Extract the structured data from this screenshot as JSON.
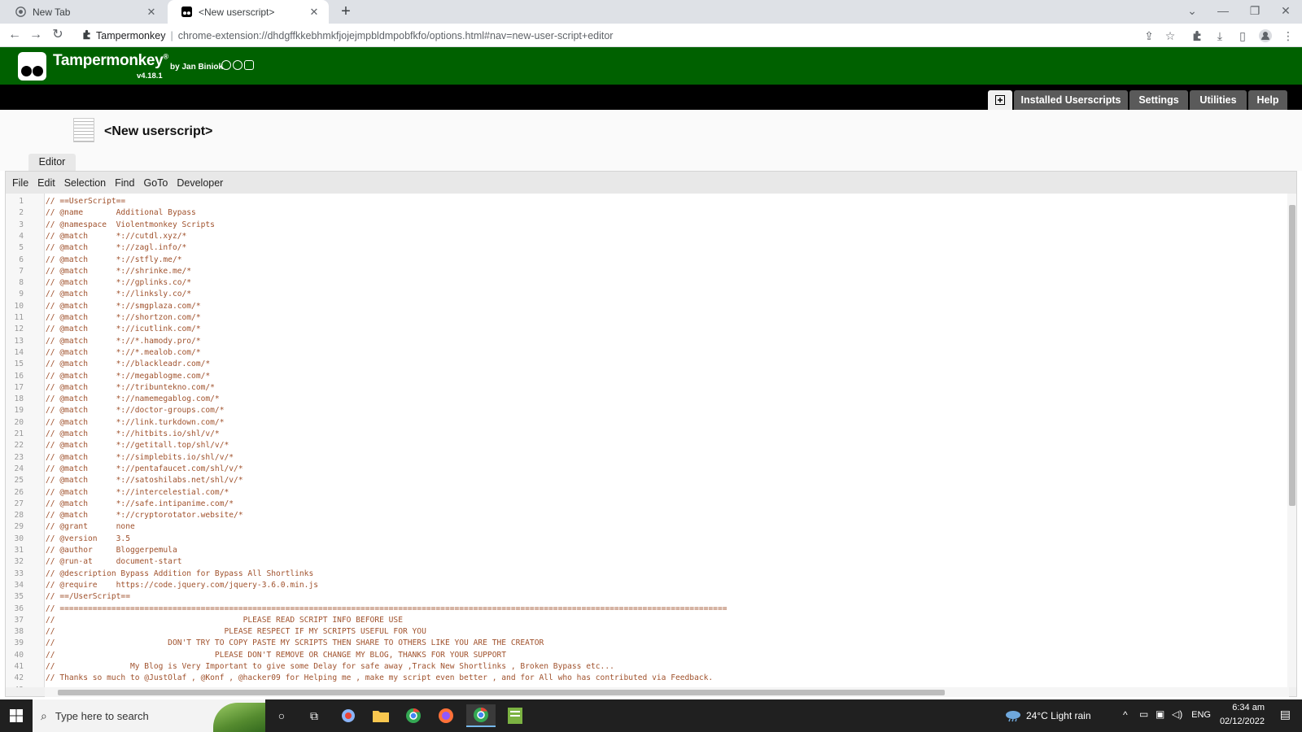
{
  "browser": {
    "tabs": [
      {
        "title": "New Tab",
        "active": false
      },
      {
        "title": "<New userscript>",
        "active": true
      }
    ],
    "omnibox": {
      "extension_name": "Tampermonkey",
      "separator": "|",
      "url": "chrome-extension://dhdgffkkebhmkfjojejmpbldmpobfkfo/options.html#nav=new-user-script+editor"
    }
  },
  "tampermonkey": {
    "title": "Tampermonkey",
    "registered": "®",
    "version": "v4.18.1",
    "by": "by Jan Biniok",
    "nav_tabs": [
      "Installed Userscripts",
      "Settings",
      "Utilities",
      "Help"
    ],
    "script_title": "<New userscript>",
    "editor_tab": "Editor",
    "editor_menu": [
      "File",
      "Edit",
      "Selection",
      "Find",
      "GoTo",
      "Developer"
    ]
  },
  "code": [
    "// ==UserScript==",
    "// @name       Additional Bypass",
    "// @namespace  Violentmonkey Scripts",
    "// @match      *://cutdl.xyz/*",
    "// @match      *://zagl.info/*",
    "// @match      *://stfly.me/*",
    "// @match      *://shrinke.me/*",
    "// @match      *://gplinks.co/*",
    "// @match      *://linksly.co/*",
    "// @match      *://smgplaza.com/*",
    "// @match      *://shortzon.com/*",
    "// @match      *://icutlink.com/*",
    "// @match      *://*.hamody.pro/*",
    "// @match      *://*.mealob.com/*",
    "// @match      *://blackleadr.com/*",
    "// @match      *://megablogme.com/*",
    "// @match      *://tribuntekno.com/*",
    "// @match      *://namemegablog.com/*",
    "// @match      *://doctor-groups.com/*",
    "// @match      *://link.turkdown.com/*",
    "// @match      *://hitbits.io/shl/v/*",
    "// @match      *://getitall.top/shl/v/*",
    "// @match      *://simplebits.io/shl/v/*",
    "// @match      *://pentafaucet.com/shl/v/*",
    "// @match      *://satoshilabs.net/shl/v/*",
    "// @match      *://intercelestial.com/*",
    "// @match      *://safe.intipanime.com/*",
    "// @match      *://cryptorotator.website/*",
    "// @grant      none",
    "// @version    3.5",
    "// @author     Bloggerpemula",
    "// @run-at     document-start",
    "// @description Bypass Addition for Bypass All Shortlinks",
    "// @require    https://code.jquery.com/jquery-3.6.0.min.js",
    "// ==/UserScript==",
    "// ==============================================================================================================================================",
    "//                                        PLEASE READ SCRIPT INFO BEFORE USE",
    "//                                    PLEASE RESPECT IF MY SCRIPTS USEFUL FOR YOU",
    "//                        DON'T TRY TO COPY PASTE MY SCRIPTS THEN SHARE TO OTHERS LIKE YOU ARE THE CREATOR",
    "//                                  PLEASE DON'T REMOVE OR CHANGE MY BLOG, THANKS FOR YOUR SUPPORT",
    "//                My Blog is Very Important to give some Delay for safe away ,Track New Shortlinks , Broken Bypass etc...",
    "// Thanks so much to @JustOlaf , @Konf , @hacker09 for Helping me , make my script even better , and for All who has contributed via Feedback.",
    ""
  ],
  "taskbar": {
    "search_placeholder": "Type here to search",
    "weather": "24°C  Light rain",
    "language": "ENG",
    "time": "6:34 am",
    "date": "02/12/2022"
  },
  "colors": {
    "tm_green": "#006100",
    "code_comment": "#a0522d",
    "taskbar": "#202020"
  }
}
